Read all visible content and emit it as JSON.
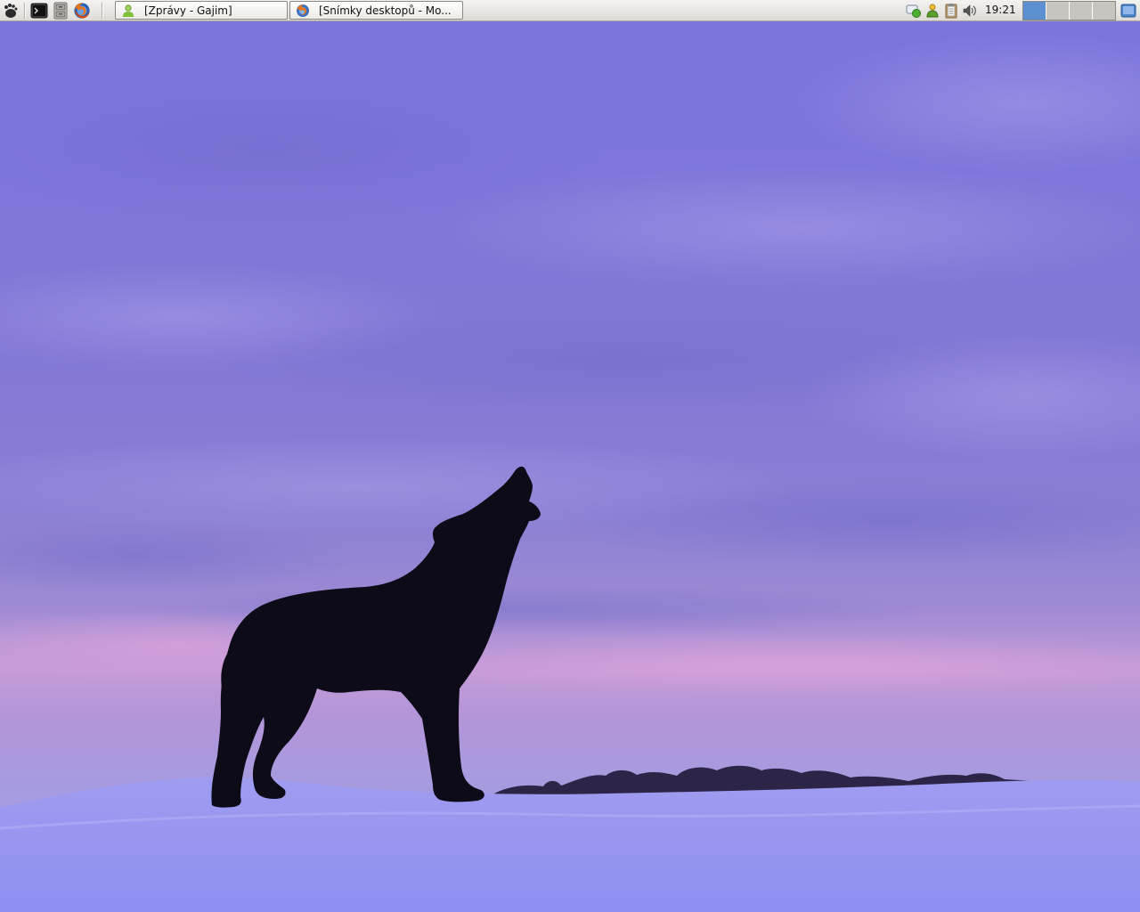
{
  "panel": {
    "launchers": [
      {
        "icon": "gnome-foot-icon",
        "label": "Main menu"
      },
      {
        "icon": "terminal-icon",
        "label": "Terminal"
      },
      {
        "icon": "file-manager-icon",
        "label": "File manager"
      },
      {
        "icon": "firefox-icon",
        "label": "Firefox"
      }
    ],
    "tasks": [
      {
        "label": "[Zprávy - Gajim]",
        "icon": "gajim-icon"
      },
      {
        "label": "[Snímky desktopů - Mo...",
        "icon": "firefox-icon"
      }
    ],
    "tray": [
      "chat-status-icon",
      "network-icon",
      "clipboard-icon",
      "volume-icon"
    ],
    "clock": "19:21",
    "workspaces": {
      "count": 4,
      "active": 1
    }
  },
  "colors": {
    "sky_top": "#7c76dc",
    "sky_mid": "#8f85d8",
    "horizon": "#c79ad6",
    "snow": "#9b9cf0",
    "silhouette": "#0c0b17",
    "panel": "#e6e3de",
    "workspace_active": "#5b8fd0"
  }
}
